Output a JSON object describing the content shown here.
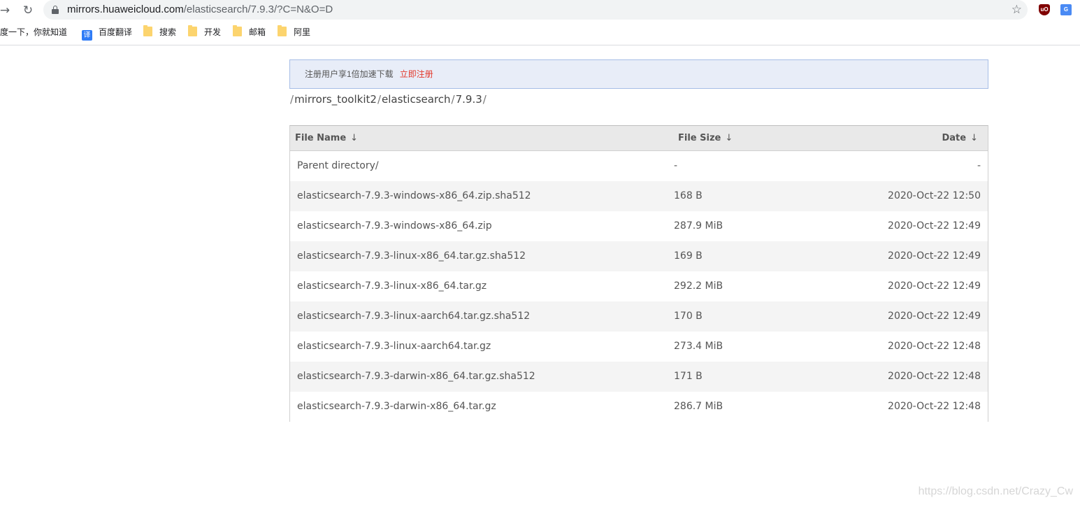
{
  "browser": {
    "url_host": "mirrors.huaweicloud.com",
    "url_path": "/elasticsearch/7.9.3/?C=N&O=D",
    "ext_ublock": "uO",
    "ext_translate": "G",
    "bookmarks": [
      {
        "label": "百度一下，你就知道",
        "icon": "none"
      },
      {
        "label": "百度翻译",
        "icon": "translate-icon"
      },
      {
        "label": "搜索",
        "icon": "folder-icon"
      },
      {
        "label": "开发",
        "icon": "folder-icon"
      },
      {
        "label": "邮箱",
        "icon": "folder-icon"
      },
      {
        "label": "阿里",
        "icon": "folder-icon"
      }
    ],
    "translate_glyph": "译"
  },
  "banner": {
    "promo": "注册用户享1倍加速下载",
    "register": "立即注册"
  },
  "breadcrumb": [
    "mirrors_toolkit2",
    "elasticsearch",
    "7.9.3"
  ],
  "table": {
    "headers": {
      "name": "File Name",
      "size": "File Size",
      "date": "Date",
      "sort_arrow": "↓"
    },
    "rows": [
      {
        "name": "Parent directory/",
        "size": "-",
        "date": "-"
      },
      {
        "name": "elasticsearch-7.9.3-windows-x86_64.zip.sha512",
        "size": "168 B",
        "date": "2020-Oct-22 12:50"
      },
      {
        "name": "elasticsearch-7.9.3-windows-x86_64.zip",
        "size": "287.9 MiB",
        "date": "2020-Oct-22 12:49"
      },
      {
        "name": "elasticsearch-7.9.3-linux-x86_64.tar.gz.sha512",
        "size": "169 B",
        "date": "2020-Oct-22 12:49"
      },
      {
        "name": "elasticsearch-7.9.3-linux-x86_64.tar.gz",
        "size": "292.2 MiB",
        "date": "2020-Oct-22 12:49"
      },
      {
        "name": "elasticsearch-7.9.3-linux-aarch64.tar.gz.sha512",
        "size": "170 B",
        "date": "2020-Oct-22 12:49"
      },
      {
        "name": "elasticsearch-7.9.3-linux-aarch64.tar.gz",
        "size": "273.4 MiB",
        "date": "2020-Oct-22 12:48"
      },
      {
        "name": "elasticsearch-7.9.3-darwin-x86_64.tar.gz.sha512",
        "size": "171 B",
        "date": "2020-Oct-22 12:48"
      },
      {
        "name": "elasticsearch-7.9.3-darwin-x86_64.tar.gz",
        "size": "286.7 MiB",
        "date": "2020-Oct-22 12:48"
      }
    ]
  },
  "watermark": "https://blog.csdn.net/Crazy_Cw"
}
